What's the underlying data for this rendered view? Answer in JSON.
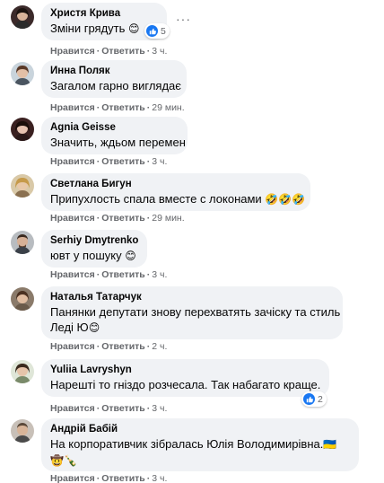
{
  "comments": [
    {
      "author": "Христя Крива",
      "text": "Зміни грядуть",
      "emoji": "😊",
      "reaction_count": "5",
      "like": "Нравится",
      "reply": "Ответить",
      "time": "3 ч."
    },
    {
      "author": "Инна Поляк",
      "text": "Загалом гарно виглядає",
      "like": "Нравится",
      "reply": "Ответить",
      "time": "29 мин."
    },
    {
      "author": "Agnia Geisse",
      "text": "Значить, ждьом перемен",
      "like": "Нравится",
      "reply": "Ответить",
      "time": "3 ч."
    },
    {
      "author": "Светлана Бигун",
      "text": "Припухлость спала вместе с локонами",
      "emoji": "🤣🤣🤣",
      "like": "Нравится",
      "reply": "Ответить",
      "time": "29 мин."
    },
    {
      "author": "Serhiy Dmytrenko",
      "text": "ювт у пошуку",
      "emoji": "😊",
      "like": "Нравится",
      "reply": "Ответить",
      "time": "3 ч."
    },
    {
      "author": "Наталья Татарчук",
      "text": "Панянки депутати знову перехватять зачіску та стиль",
      "text2": "Леді Ю",
      "emoji": "😊",
      "like": "Нравится",
      "reply": "Ответить",
      "time": "2 ч."
    },
    {
      "author": "Yuliia Lavryshyn",
      "text": "Нарешті то гніздо розчесала. Так набагато краще.",
      "reaction_count": "2",
      "like": "Нравится",
      "reply": "Ответить",
      "time": "3 ч."
    },
    {
      "author": "Андрій Бабій",
      "text": "На корпоративчик зібралась Юлія Володимирівна.",
      "emoji": "🇺🇦",
      "emoji2": "🤠🍾",
      "like": "Нравится",
      "reply": "Ответить",
      "time": "3 ч."
    }
  ],
  "more_menu": "···",
  "colors": {
    "bubble": "#f0f2f5",
    "meta_text": "#65676b",
    "like_blue": "#1877f2"
  }
}
